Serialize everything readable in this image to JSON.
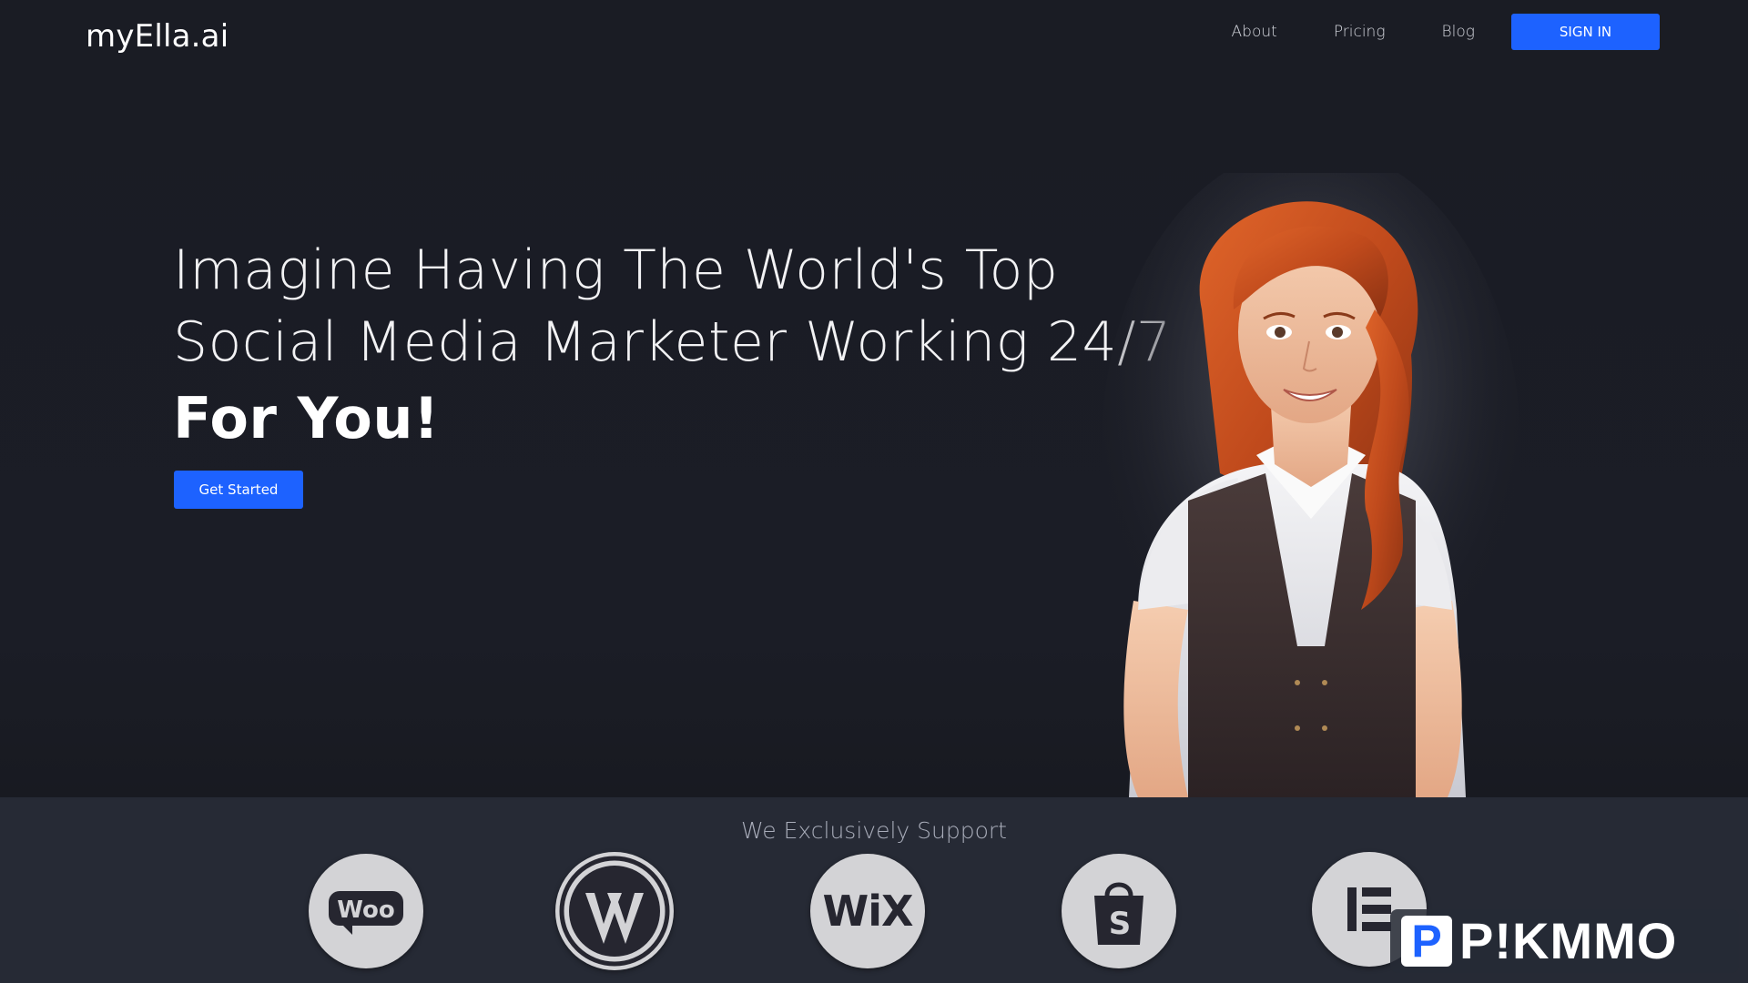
{
  "header": {
    "logo": "myElla.ai",
    "nav": [
      {
        "label": "About"
      },
      {
        "label": "Pricing"
      },
      {
        "label": "Blog"
      }
    ],
    "signin_label": "SIGN IN"
  },
  "hero": {
    "line1": "Imagine Having The World's Top",
    "line2": "Social Media Marketer Working 24/7",
    "line3": "For You!",
    "cta_label": "Get Started"
  },
  "support": {
    "title": "We Exclusively Support",
    "platforms": [
      {
        "name": "woocommerce-icon",
        "label": "Woo"
      },
      {
        "name": "wordpress-icon",
        "label": ""
      },
      {
        "name": "wix-icon",
        "label": "WiX"
      },
      {
        "name": "shopify-icon",
        "label": ""
      },
      {
        "name": "elementor-icon",
        "label": ""
      }
    ]
  },
  "watermark": {
    "letter": "P",
    "text": "P!KMMO"
  },
  "colors": {
    "background": "#1b1d26",
    "accent": "#1d62ff",
    "band": "#262a35",
    "icon_circle": "#d3d3d6"
  }
}
